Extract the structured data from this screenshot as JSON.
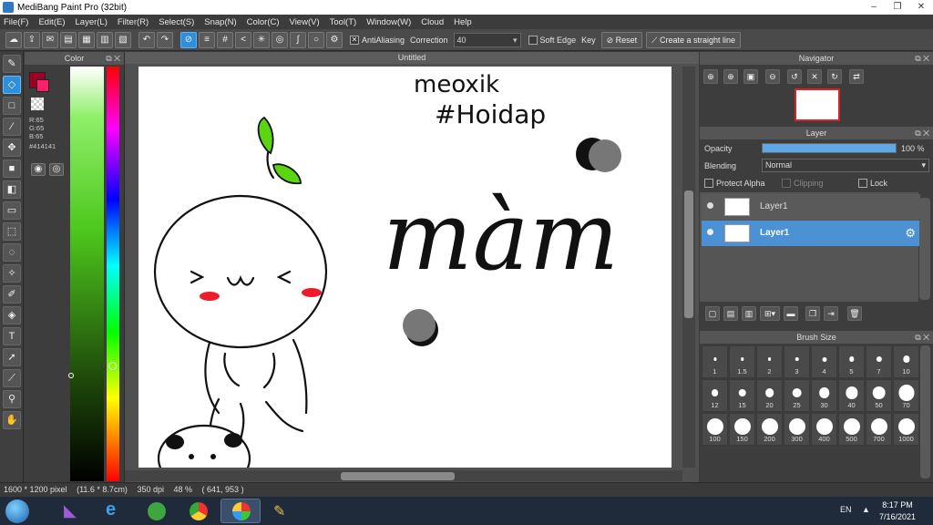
{
  "app": {
    "title": "MediBang Paint Pro (32bit)",
    "window_controls": [
      "–",
      "❐",
      "✕"
    ]
  },
  "menu": [
    "File(F)",
    "Edit(E)",
    "Layer(L)",
    "Filter(R)",
    "Select(S)",
    "Snap(N)",
    "Color(C)",
    "View(V)",
    "Tool(T)",
    "Window(W)",
    "Cloud",
    "Help"
  ],
  "toolbar": {
    "antialiasing_label": "AntiAliasing",
    "antialiasing_checked": true,
    "correction_label": "Correction",
    "correction_value": "40",
    "soft_edge_label": "Soft Edge",
    "soft_edge_checked": false,
    "key_label": "Key",
    "reset_label": "Reset",
    "straight_line_label": "Create a straight line"
  },
  "color_panel": {
    "title": "Color",
    "primary_color": "#9e0024",
    "secondary_color": "#ff1e6a",
    "r_label": "R:65",
    "g_label": "G:65",
    "b_label": "B:65",
    "hex_label": "#414141"
  },
  "document": {
    "tab_title": "Untitled",
    "text_line1": "meoxik",
    "text_line2": "#Hoidap",
    "big_word": "màm",
    "face": ">ω<"
  },
  "navigator": {
    "title": "Navigator"
  },
  "layer_panel": {
    "title": "Layer",
    "opacity_label": "Opacity",
    "opacity_value": "100 %",
    "opacity_fraction": 1.0,
    "blending_label": "Blending",
    "blending_value": "Normal",
    "protect_alpha_label": "Protect Alpha",
    "clipping_label": "Clipping",
    "lock_label": "Lock",
    "layers": [
      {
        "name": "Layer1",
        "selected": false
      },
      {
        "name": "Layer1",
        "selected": true
      }
    ]
  },
  "brush_size": {
    "title": "Brush Size",
    "sizes": [
      "1",
      "1.5",
      "2",
      "3",
      "4",
      "5",
      "7",
      "10",
      "12",
      "15",
      "20",
      "25",
      "30",
      "40",
      "50",
      "70",
      "100",
      "150",
      "200",
      "300",
      "400",
      "500",
      "700",
      "1000"
    ]
  },
  "status": {
    "dimensions": "1600 * 1200 pixel",
    "physical": "(11.6 * 8.7cm)",
    "dpi": "350 dpi",
    "zoom": "48 %",
    "coords": "( 641, 953 )"
  },
  "taskbar": {
    "language": "EN",
    "time": "8:17 PM",
    "date": "7/16/2021"
  }
}
